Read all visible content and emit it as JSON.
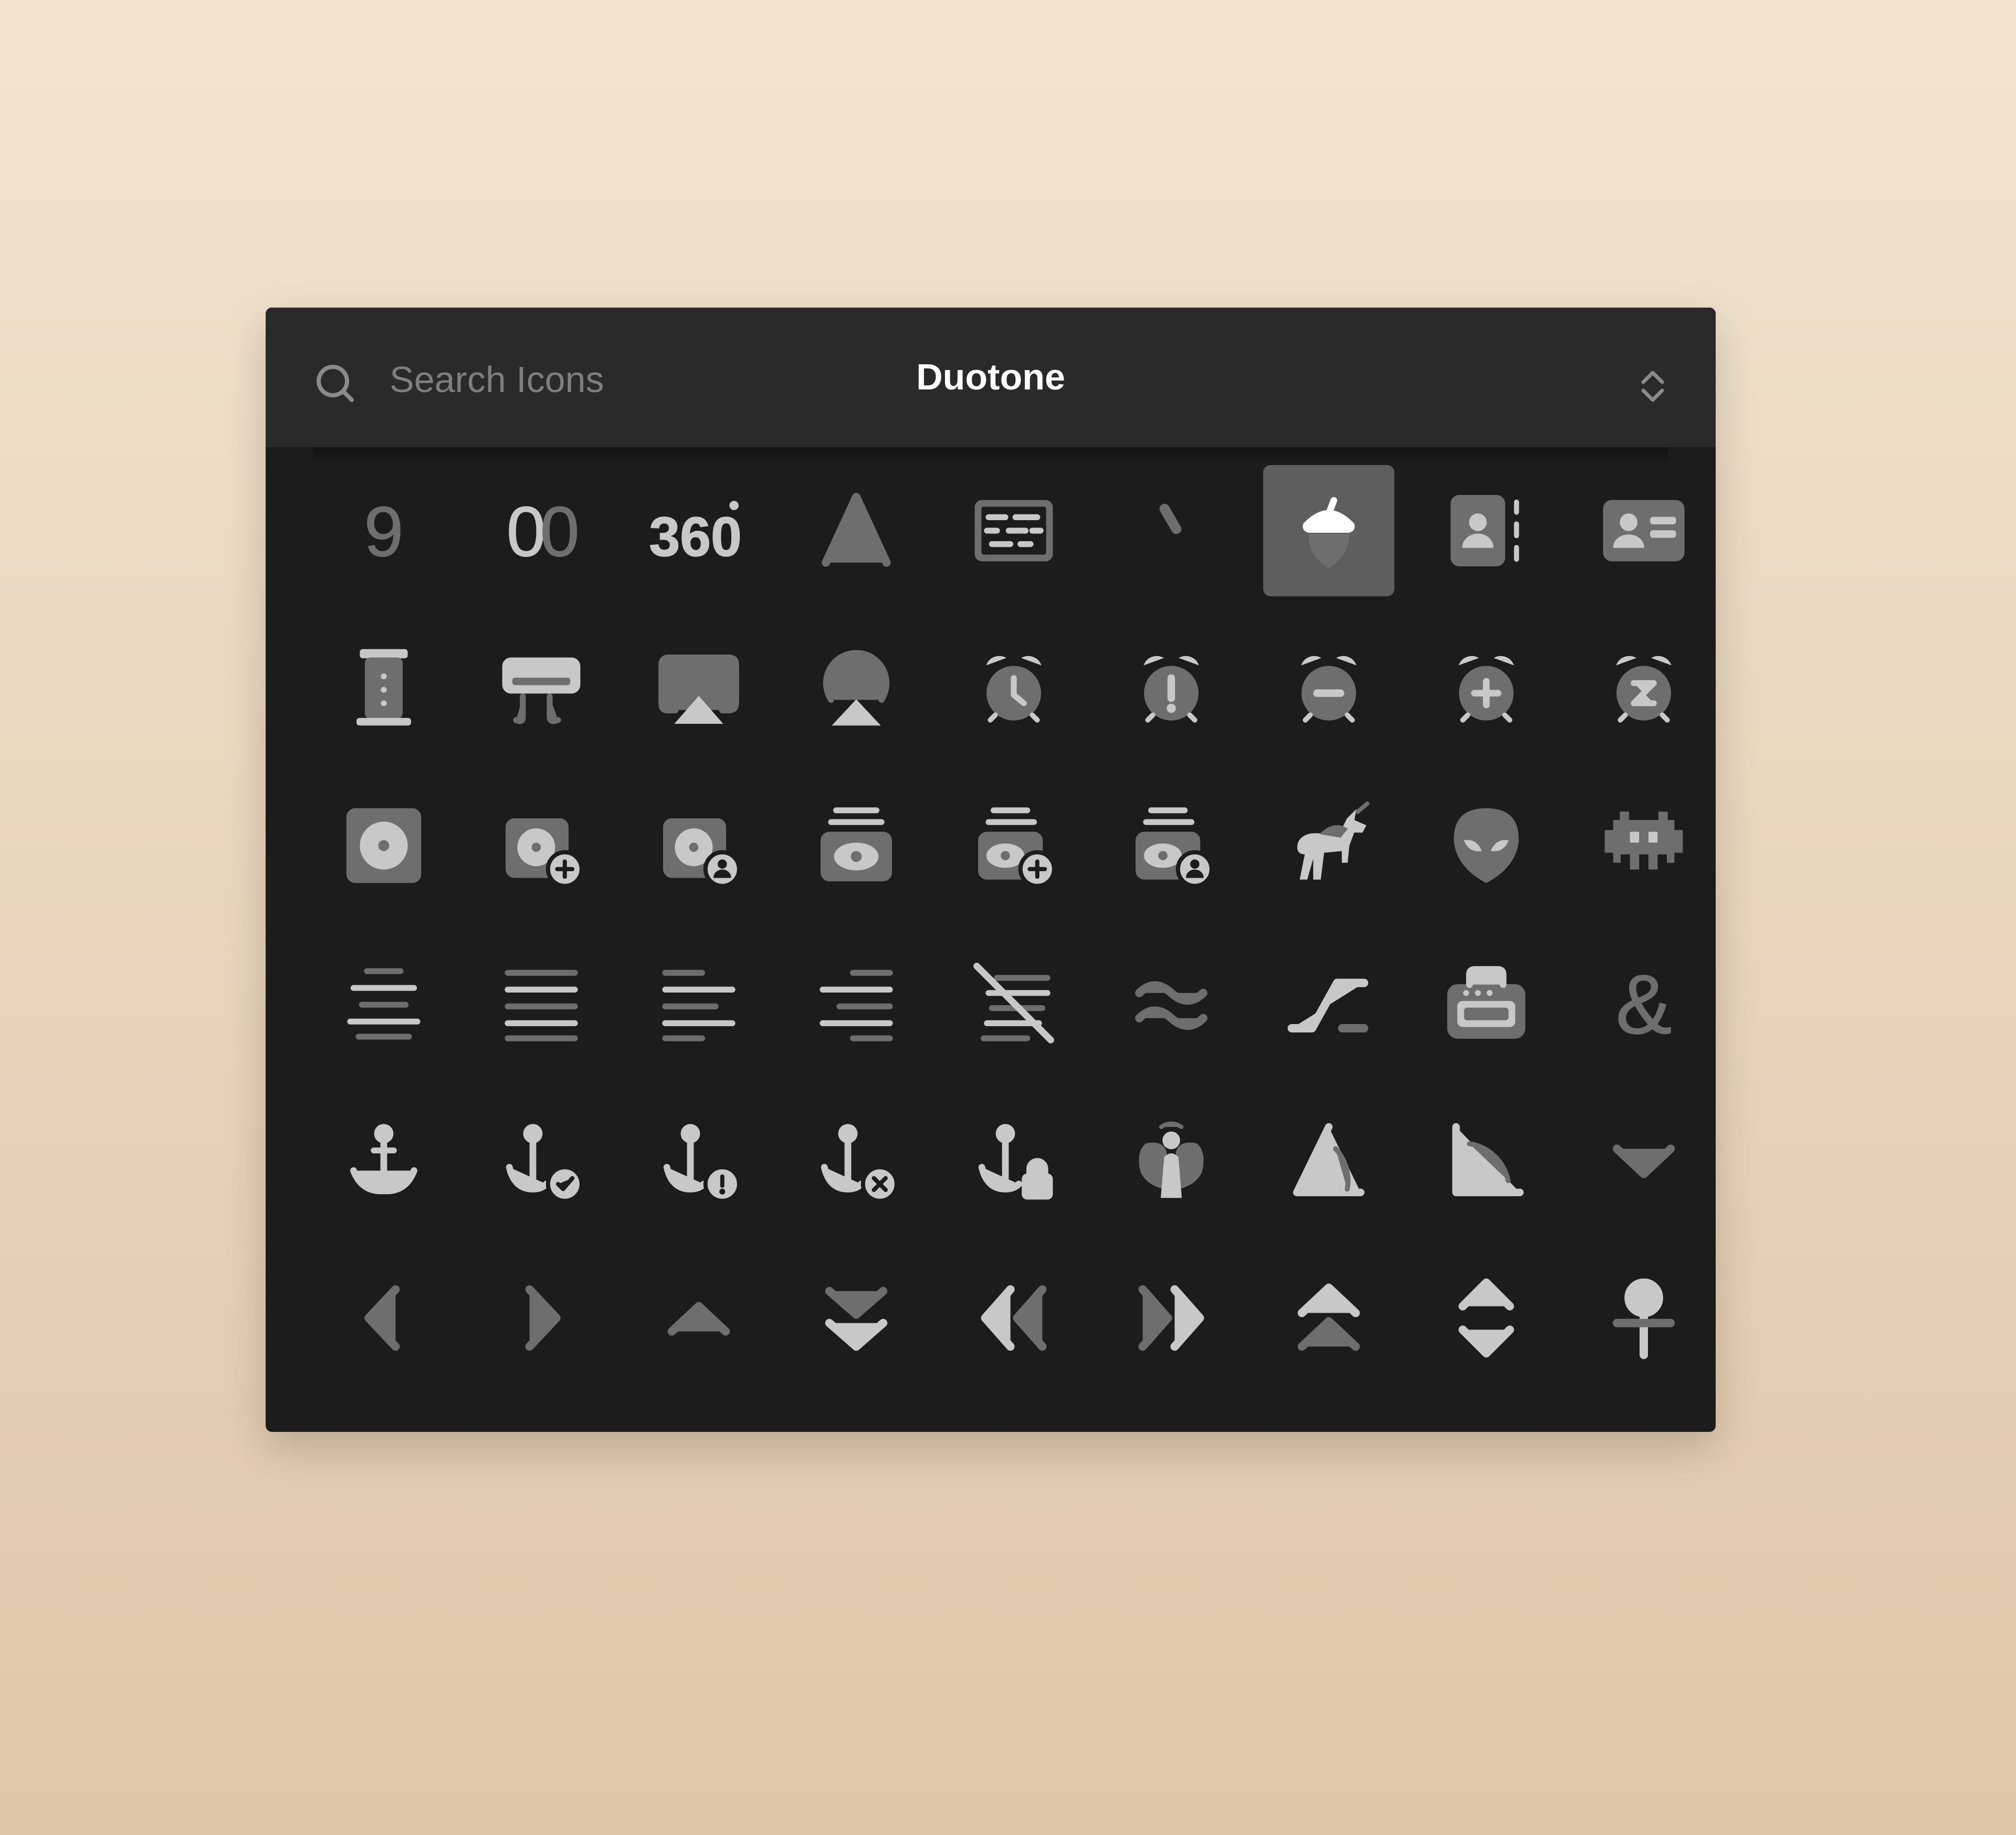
{
  "search": {
    "placeholder": "Search Icons"
  },
  "style_selector": {
    "label": "Duotone"
  },
  "colors": {
    "panel": "#1c1c1c",
    "header": "#2a2a2a",
    "icon_primary": "#c8c8c8",
    "icon_secondary": "#6e6e6e",
    "selected_bg": "#5e5e5e"
  },
  "icons": [
    {
      "name": "nine",
      "glyph": "9"
    },
    {
      "name": "zero-zero",
      "glyph": "00"
    },
    {
      "name": "three-sixty",
      "glyph": "360°"
    },
    {
      "name": "letter-a",
      "glyph": "A"
    },
    {
      "name": "abacus"
    },
    {
      "name": "accent-grave"
    },
    {
      "name": "acorn",
      "selected": true
    },
    {
      "name": "address-book"
    },
    {
      "name": "address-card"
    },
    {
      "name": "aeropress"
    },
    {
      "name": "air-conditioner"
    },
    {
      "name": "airplay"
    },
    {
      "name": "alarm-broadcast"
    },
    {
      "name": "alarm-clock"
    },
    {
      "name": "alarm-exclamation"
    },
    {
      "name": "alarm-minus"
    },
    {
      "name": "alarm-plus"
    },
    {
      "name": "alarm-snooze"
    },
    {
      "name": "album"
    },
    {
      "name": "album-circle-plus"
    },
    {
      "name": "album-circle-user"
    },
    {
      "name": "album-collection"
    },
    {
      "name": "album-collection-circle-plus"
    },
    {
      "name": "album-collection-circle-user"
    },
    {
      "name": "alicorn"
    },
    {
      "name": "alien"
    },
    {
      "name": "alien-8bit"
    },
    {
      "name": "align-center"
    },
    {
      "name": "align-justify"
    },
    {
      "name": "align-left"
    },
    {
      "name": "align-right"
    },
    {
      "name": "align-slash"
    },
    {
      "name": "almost-equal-to"
    },
    {
      "name": "alt"
    },
    {
      "name": "amp-guitar"
    },
    {
      "name": "ampersand"
    },
    {
      "name": "anchor"
    },
    {
      "name": "anchor-circle-check"
    },
    {
      "name": "anchor-circle-exclamation"
    },
    {
      "name": "anchor-circle-xmark"
    },
    {
      "name": "anchor-lock"
    },
    {
      "name": "angel"
    },
    {
      "name": "angle"
    },
    {
      "name": "angle-90"
    },
    {
      "name": "angle-down"
    },
    {
      "name": "angle-left"
    },
    {
      "name": "angle-right"
    },
    {
      "name": "angle-up"
    },
    {
      "name": "angles-down"
    },
    {
      "name": "angles-left"
    },
    {
      "name": "angles-right"
    },
    {
      "name": "angles-up"
    },
    {
      "name": "angles-up-down"
    },
    {
      "name": "ankh"
    }
  ]
}
